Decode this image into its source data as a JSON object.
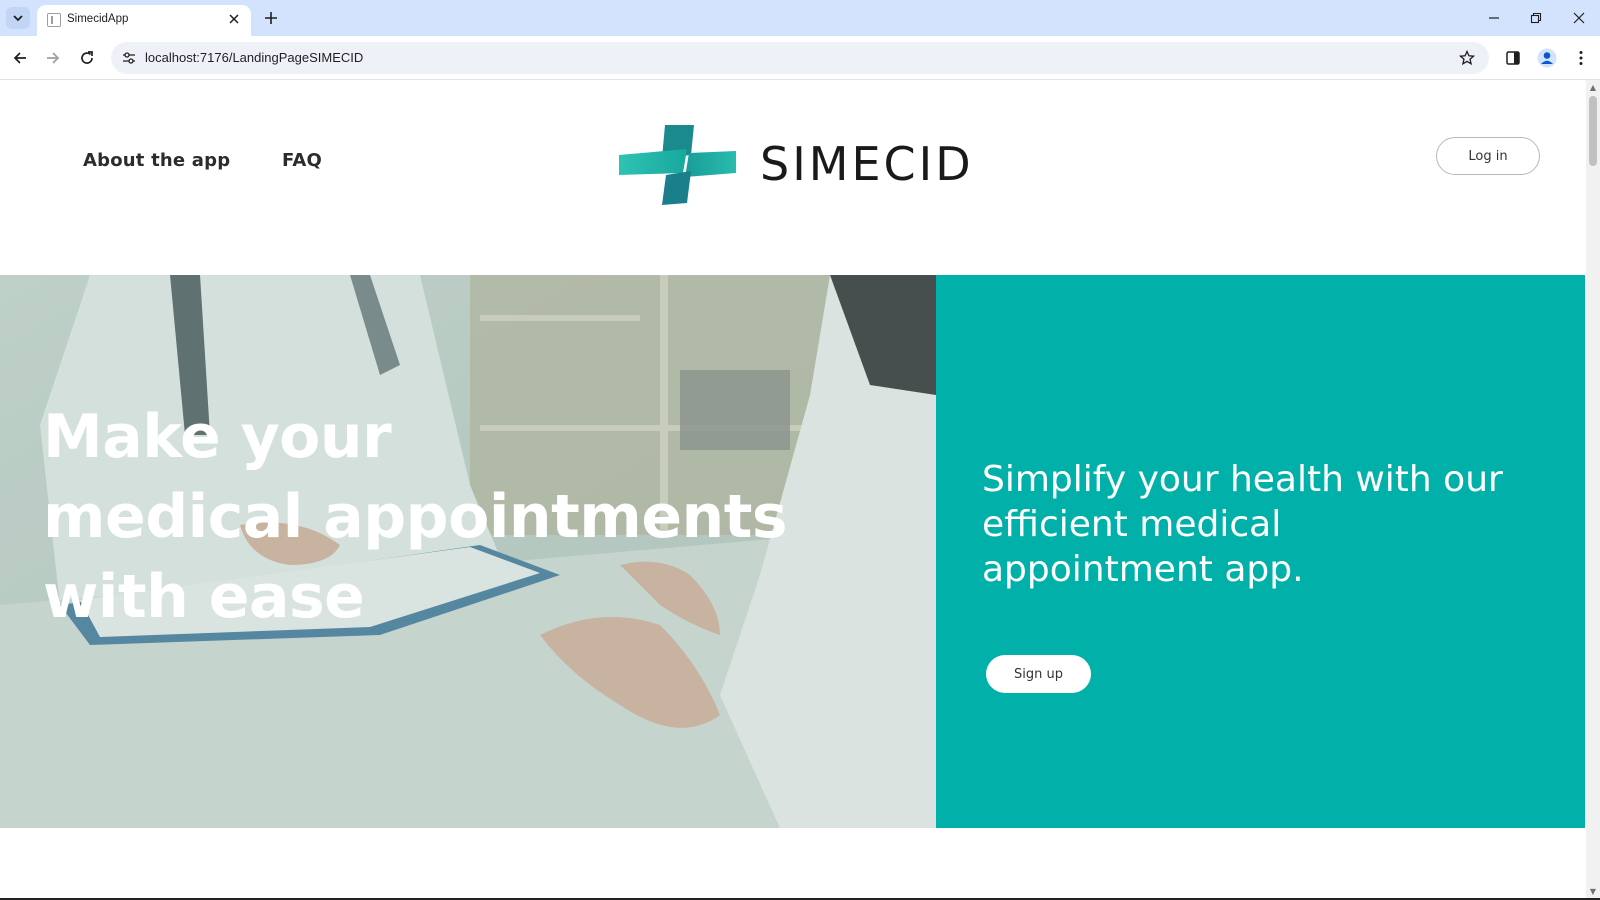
{
  "browser": {
    "tab_title": "SimecidApp",
    "url": "localhost:7176/LandingPageSIMECID"
  },
  "nav": {
    "about": "About the app",
    "faq": "FAQ",
    "login": "Log in"
  },
  "logo": {
    "text": "SIMECID",
    "colors": {
      "primary": "#14b5a8",
      "secondary": "#1a7f8a"
    }
  },
  "hero": {
    "title_lines": [
      "Make your",
      "medical appointments",
      "with ease"
    ],
    "subtitle_lines": [
      "Simplify your health with our",
      "efficient medical",
      "appointment app."
    ],
    "signup": "Sign up",
    "panel_color": "#02b0aa"
  }
}
